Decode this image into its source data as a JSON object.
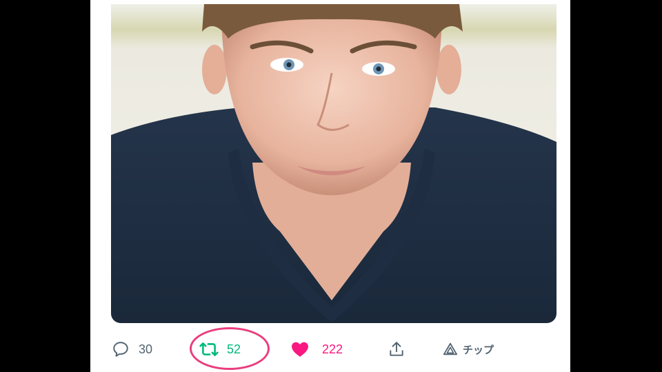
{
  "post": {
    "media_alt": "photo"
  },
  "actions": {
    "reply": {
      "icon": "reply-icon",
      "count": "30"
    },
    "retweet": {
      "icon": "retweet-icon",
      "count": "52"
    },
    "like": {
      "icon": "heart-icon",
      "count": "222"
    },
    "share": {
      "icon": "share-icon"
    },
    "tip": {
      "icon": "tip-icon",
      "label": "チップ"
    }
  },
  "colors": {
    "like": "#f91880",
    "retweet": "#00ba7c",
    "muted": "#536471",
    "highlight": "#ea3d7d"
  }
}
